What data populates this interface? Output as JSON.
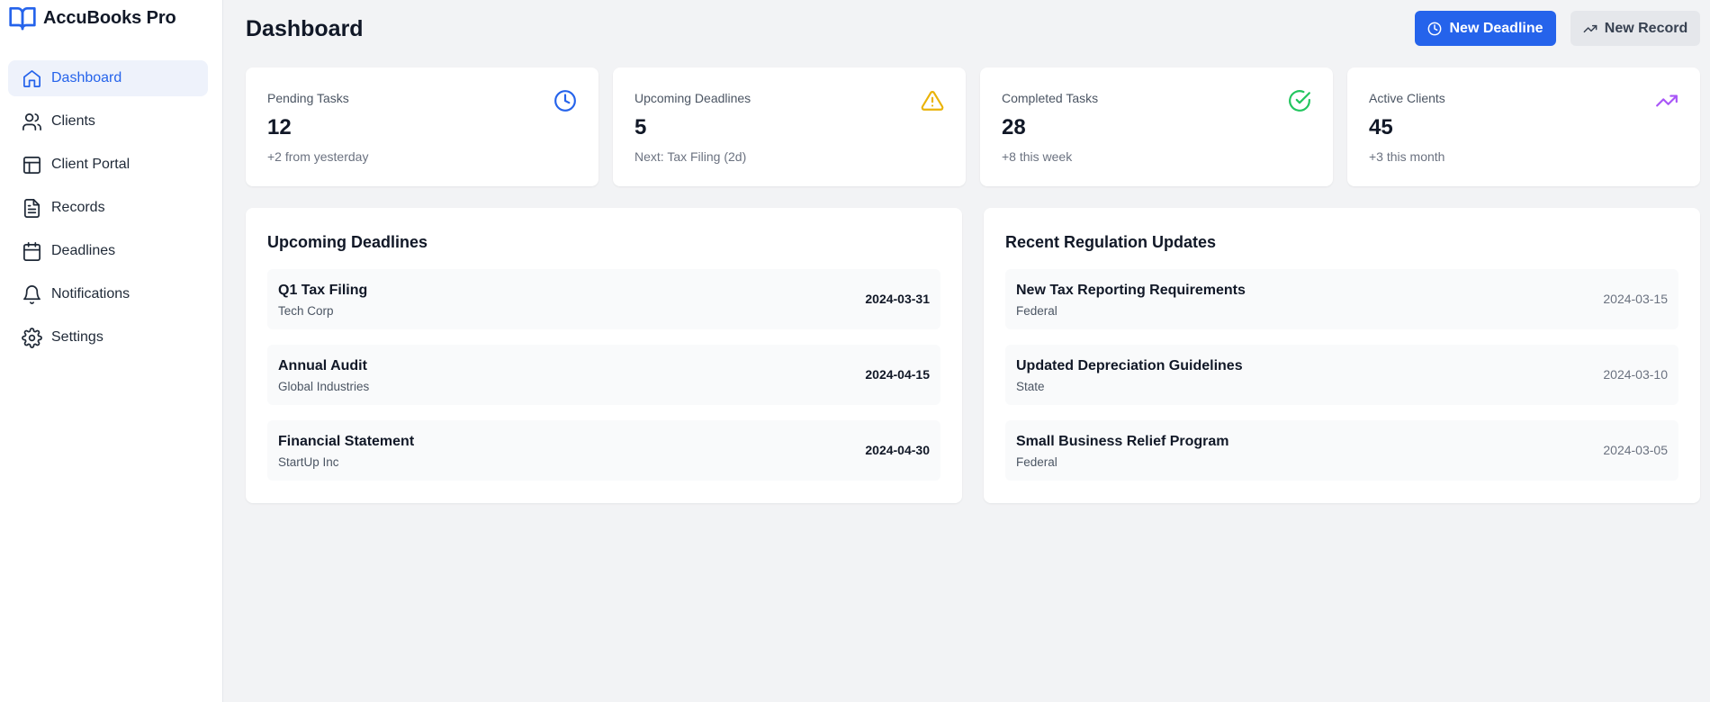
{
  "app": {
    "name": "AccuBooks Pro"
  },
  "sidebar": {
    "items": [
      {
        "label": "Dashboard",
        "icon": "home-icon",
        "active": true
      },
      {
        "label": "Clients",
        "icon": "users-icon"
      },
      {
        "label": "Client Portal",
        "icon": "layout-icon"
      },
      {
        "label": "Records",
        "icon": "file-text-icon"
      },
      {
        "label": "Deadlines",
        "icon": "calendar-icon"
      },
      {
        "label": "Notifications",
        "icon": "bell-icon"
      },
      {
        "label": "Settings",
        "icon": "gear-icon"
      }
    ]
  },
  "header": {
    "title": "Dashboard",
    "primary_button": "New Deadline",
    "secondary_button": "New Record"
  },
  "stats": [
    {
      "label": "Pending Tasks",
      "value": "12",
      "sub": "+2 from yesterday",
      "icon": "clock-icon",
      "color": "#2563eb"
    },
    {
      "label": "Upcoming Deadlines",
      "value": "5",
      "sub": "Next: Tax Filing (2d)",
      "icon": "alert-triangle-icon",
      "color": "#eab308"
    },
    {
      "label": "Completed Tasks",
      "value": "28",
      "sub": "+8 this week",
      "icon": "check-circle-icon",
      "color": "#22c55e"
    },
    {
      "label": "Active Clients",
      "value": "45",
      "sub": "+3 this month",
      "icon": "trending-up-icon",
      "color": "#a855f7"
    }
  ],
  "deadlines": {
    "title": "Upcoming Deadlines",
    "items": [
      {
        "title": "Q1 Tax Filing",
        "client": "Tech Corp",
        "date": "2024-03-31"
      },
      {
        "title": "Annual Audit",
        "client": "Global Industries",
        "date": "2024-04-15"
      },
      {
        "title": "Financial Statement",
        "client": "StartUp Inc",
        "date": "2024-04-30"
      }
    ]
  },
  "regulations": {
    "title": "Recent Regulation Updates",
    "items": [
      {
        "title": "New Tax Reporting Requirements",
        "scope": "Federal",
        "date": "2024-03-15"
      },
      {
        "title": "Updated Depreciation Guidelines",
        "scope": "State",
        "date": "2024-03-10"
      },
      {
        "title": "Small Business Relief Program",
        "scope": "Federal",
        "date": "2024-03-05"
      }
    ]
  },
  "colors": {
    "accent": "#2563eb",
    "background": "#f2f3f5"
  }
}
